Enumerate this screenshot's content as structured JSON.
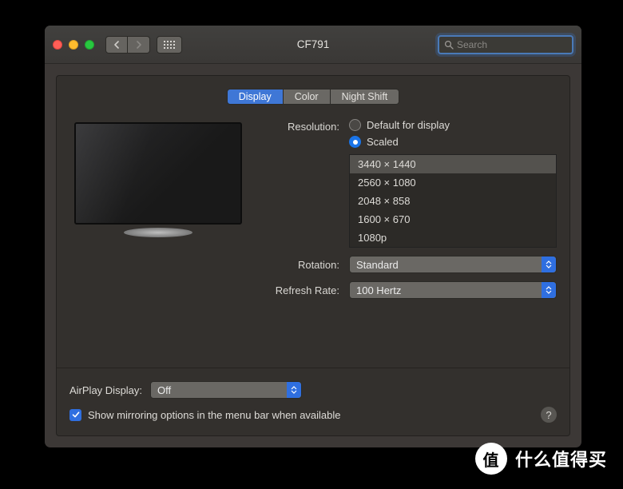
{
  "window": {
    "title": "CF791"
  },
  "search": {
    "placeholder": "Search"
  },
  "tabs": [
    {
      "label": "Display",
      "active": true
    },
    {
      "label": "Color",
      "active": false
    },
    {
      "label": "Night Shift",
      "active": false
    }
  ],
  "resolution": {
    "label": "Resolution:",
    "options": {
      "default": "Default for display",
      "scaled": "Scaled"
    },
    "selected": "scaled",
    "list": [
      {
        "label": "3440 × 1440",
        "selected": true
      },
      {
        "label": "2560 × 1080",
        "selected": false
      },
      {
        "label": "2048 × 858",
        "selected": false
      },
      {
        "label": "1600 × 670",
        "selected": false
      },
      {
        "label": "1080p",
        "selected": false
      }
    ]
  },
  "rotation": {
    "label": "Rotation:",
    "value": "Standard"
  },
  "refresh": {
    "label": "Refresh Rate:",
    "value": "100 Hertz"
  },
  "airplay": {
    "label": "AirPlay Display:",
    "value": "Off"
  },
  "mirroring": {
    "checked": true,
    "label": "Show mirroring options in the menu bar when available"
  },
  "help": {
    "label": "?"
  },
  "watermark": {
    "text": "什么值得买",
    "badge": "值"
  }
}
